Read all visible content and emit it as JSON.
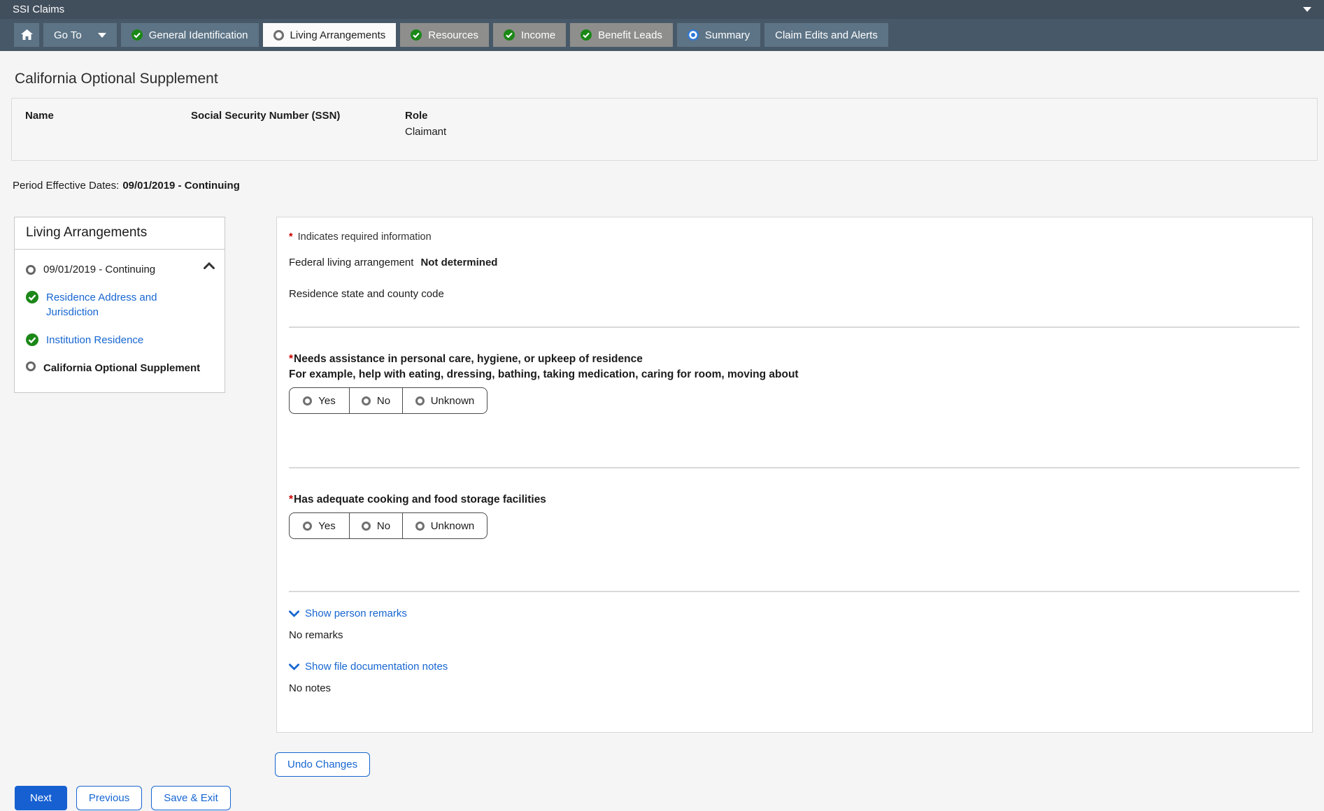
{
  "app": {
    "title": "SSI Claims"
  },
  "nav": {
    "go_to_label": "Go To",
    "tabs": [
      {
        "label": "General Identification",
        "status": "complete"
      },
      {
        "label": "Living Arrangements",
        "status": "current"
      },
      {
        "label": "Resources",
        "status": "complete"
      },
      {
        "label": "Income",
        "status": "complete"
      },
      {
        "label": "Benefit Leads",
        "status": "complete"
      },
      {
        "label": "Summary",
        "status": "in_progress"
      },
      {
        "label": "Claim Edits and Alerts",
        "status": "none"
      }
    ]
  },
  "page": {
    "title": "California Optional Supplement"
  },
  "person_table": {
    "headers": {
      "name": "Name",
      "ssn": "Social Security Number (SSN)",
      "role": "Role"
    },
    "row": {
      "name": "",
      "ssn": "",
      "role": "Claimant"
    }
  },
  "period": {
    "label": "Period Effective Dates:",
    "value": "09/01/2019 - Continuing"
  },
  "sidebar": {
    "title": "Living Arrangements",
    "items": [
      {
        "label": "09/01/2019 - Continuing",
        "status": "expanded"
      },
      {
        "label": "Residence Address and Jurisdiction",
        "status": "complete"
      },
      {
        "label": "Institution Residence",
        "status": "complete"
      },
      {
        "label": "California Optional Supplement",
        "status": "current"
      }
    ]
  },
  "main": {
    "required_marker": "*",
    "required_note": "Indicates required information",
    "federal_living_arrangement": {
      "label": "Federal living arrangement",
      "value": "Not determined"
    },
    "residence_code_label": "Residence state and county code",
    "questions": [
      {
        "title": "Needs assistance in personal care, hygiene, or upkeep of residence",
        "hint": "For example, help with eating, dressing, bathing, taking medication, caring for room, moving about",
        "options": [
          "Yes",
          "No",
          "Unknown"
        ],
        "selected": ""
      },
      {
        "title": "Has adequate cooking and food storage facilities",
        "options": [
          "Yes",
          "No",
          "Unknown"
        ],
        "selected": ""
      }
    ],
    "remarks": {
      "toggle_label": "Show person remarks",
      "content": "No remarks"
    },
    "notes": {
      "toggle_label": "Show file documentation notes",
      "content": "No notes"
    },
    "undo_label": "Undo Changes"
  },
  "footer": {
    "next": "Next",
    "previous": "Previous",
    "save_exit": "Save & Exit"
  },
  "colors": {
    "accent_blue": "#1766d1",
    "success_green": "#1b8718",
    "required_red": "#cc0000"
  }
}
